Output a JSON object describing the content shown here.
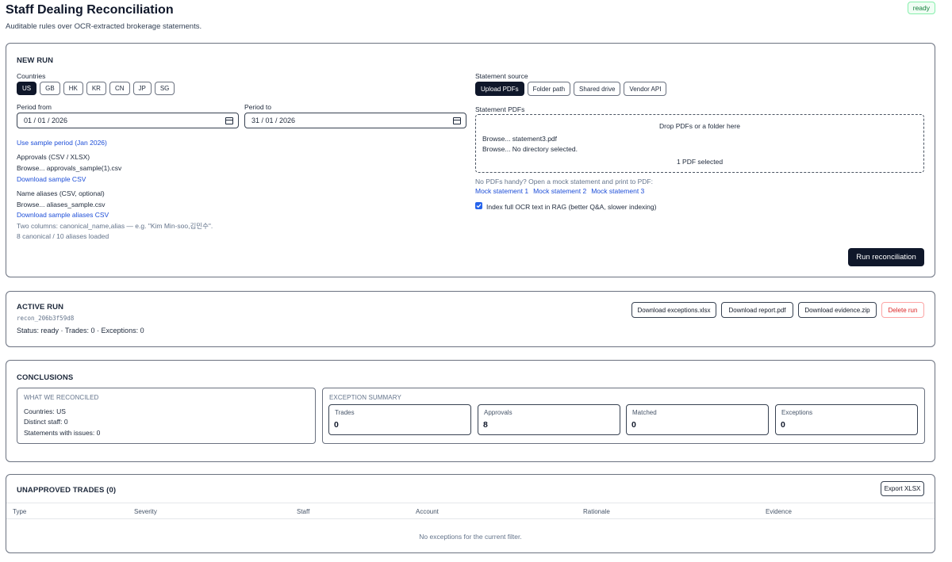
{
  "header": {
    "title": "Staff Dealing Reconciliation",
    "subtitle": "Auditable rules over OCR-extracted brokerage statements.",
    "status": "ready"
  },
  "new_run": {
    "title": "NEW RUN",
    "countries_label": "Countries",
    "countries": [
      {
        "code": "US",
        "active": true
      },
      {
        "code": "GB",
        "active": false
      },
      {
        "code": "HK",
        "active": false
      },
      {
        "code": "KR",
        "active": false
      },
      {
        "code": "CN",
        "active": false
      },
      {
        "code": "JP",
        "active": false
      },
      {
        "code": "SG",
        "active": false
      }
    ],
    "period_from_label": "Period from",
    "period_from_value": "01 / 01 / 2026",
    "period_to_label": "Period to",
    "period_to_value": "31 / 01 / 2026",
    "sample_period_link": "Use sample period (Jan 2026)",
    "approvals_label": "Approvals (CSV / XLSX)",
    "approvals_file": "Browse... approvals_sample(1).csv",
    "approvals_download": "Download sample CSV",
    "aliases_label": "Name aliases (CSV, optional)",
    "aliases_file": "Browse... aliases_sample.csv",
    "aliases_download": "Download sample aliases CSV",
    "aliases_hint": "Two columns: canonical_name,alias — e.g. \"Kim Min-soo,김민수\".",
    "aliases_loaded": "8 canonical / 10 aliases loaded",
    "source_label": "Statement source",
    "sources": [
      {
        "label": "Upload PDFs",
        "active": true
      },
      {
        "label": "Folder path",
        "active": false
      },
      {
        "label": "Shared drive",
        "active": false
      },
      {
        "label": "Vendor API",
        "active": false
      }
    ],
    "pdfs_label": "Statement PDFs",
    "dropzone_text": "Drop PDFs or a folder here",
    "pdf_file": "Browse... statement3.pdf",
    "pdf_dir": "Browse... No directory selected.",
    "pdf_count": "1 PDF selected",
    "mock_hint": "No PDFs handy? Open a mock statement and print to PDF:",
    "mock_links": [
      "Mock statement 1",
      "Mock statement 2",
      "Mock statement 3"
    ],
    "index_checkbox_label": "Index full OCR text in RAG (better Q&A, slower indexing)",
    "index_checked": true,
    "run_button": "Run reconciliation"
  },
  "active_run": {
    "title": "ACTIVE RUN",
    "run_id": "recon_206b3f59d8",
    "status_line": "Status: ready · Trades: 0 · Exceptions: 0",
    "buttons": {
      "exceptions": "Download exceptions.xlsx",
      "report": "Download report.pdf",
      "evidence": "Download evidence.zip",
      "delete": "Delete run"
    }
  },
  "conclusions": {
    "title": "CONCLUSIONS",
    "reconciled_title": "WHAT WE RECONCILED",
    "reconciled_lines": [
      "Countries: US",
      "Distinct staff: 0",
      "Statements with issues: 0"
    ],
    "summary_title": "EXCEPTION SUMMARY",
    "stats": [
      {
        "label": "Trades",
        "value": "0"
      },
      {
        "label": "Approvals",
        "value": "8"
      },
      {
        "label": "Matched",
        "value": "0"
      },
      {
        "label": "Exceptions",
        "value": "0"
      }
    ]
  },
  "unapproved": {
    "title": "UNAPPROVED TRADES (0)",
    "export_button": "Export XLSX",
    "columns": [
      "Type",
      "Severity",
      "Staff",
      "Account",
      "Rationale",
      "Evidence"
    ],
    "empty_message": "No exceptions for the current filter."
  }
}
